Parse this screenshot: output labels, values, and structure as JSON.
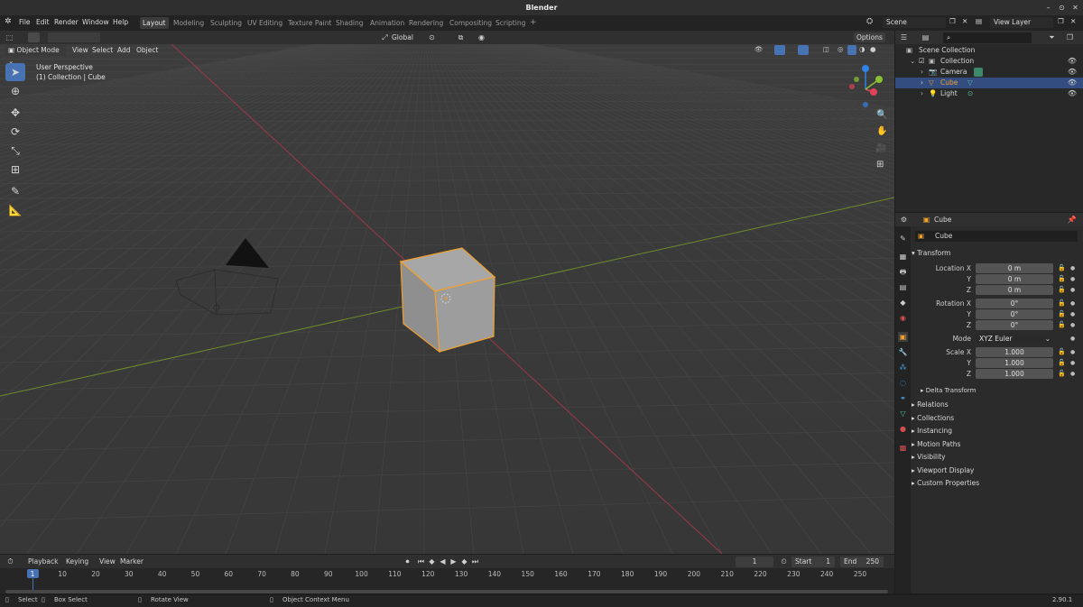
{
  "window": {
    "title": "Blender"
  },
  "menu": [
    "File",
    "Edit",
    "Render",
    "Window",
    "Help"
  ],
  "workspaces": [
    "Layout",
    "Modeling",
    "Sculpting",
    "UV Editing",
    "Texture Paint",
    "Shading",
    "Animation",
    "Rendering",
    "Compositing",
    "Scripting"
  ],
  "active_workspace": "Layout",
  "scene": {
    "name": "Scene",
    "view_layer": "View Layer"
  },
  "viewport_header": {
    "mode": "Object Mode",
    "menus": [
      "View",
      "Select",
      "Add",
      "Object"
    ],
    "transform_orientation": "Global",
    "options": "Options"
  },
  "viewport": {
    "perspective": "User Perspective",
    "context": "(1) Collection | Cube",
    "gizmo_axes": [
      "X",
      "Y",
      "Z"
    ]
  },
  "outliner": {
    "search_placeholder": "",
    "items": [
      {
        "label": "Scene Collection",
        "depth": 0,
        "icon": "scene-collection-icon"
      },
      {
        "label": "Collection",
        "depth": 1,
        "icon": "collection-icon"
      },
      {
        "label": "Camera",
        "depth": 2,
        "icon": "camera-icon"
      },
      {
        "label": "Cube",
        "depth": 2,
        "icon": "mesh-icon",
        "selected": true
      },
      {
        "label": "Light",
        "depth": 2,
        "icon": "light-icon"
      }
    ]
  },
  "properties": {
    "object_name": "Cube",
    "object_field": "Cube",
    "transform_title": "Transform",
    "location": {
      "label": "Location X",
      "x": "0 m",
      "y": "0 m",
      "z": "0 m"
    },
    "rotation": {
      "label": "Rotation X",
      "x": "0°",
      "y": "0°",
      "z": "0°"
    },
    "mode": {
      "label": "Mode",
      "value": "XYZ Euler"
    },
    "scale": {
      "label": "Scale X",
      "x": "1.000",
      "y": "1.000",
      "z": "1.000"
    },
    "axis_labels": {
      "y": "Y",
      "z": "Z"
    },
    "delta_transform": "Delta Transform",
    "sections": [
      "Relations",
      "Collections",
      "Instancing",
      "Motion Paths",
      "Visibility",
      "Viewport Display",
      "Custom Properties"
    ]
  },
  "timeline": {
    "menus": [
      "Playback",
      "Keying",
      "View",
      "Marker"
    ],
    "current_frame": "1",
    "start_label": "Start",
    "start": "1",
    "end_label": "End",
    "end": "250",
    "ticks": [
      "1",
      "10",
      "20",
      "30",
      "40",
      "50",
      "60",
      "70",
      "80",
      "90",
      "100",
      "110",
      "120",
      "130",
      "140",
      "150",
      "160",
      "170",
      "180",
      "190",
      "200",
      "210",
      "220",
      "230",
      "240",
      "250"
    ]
  },
  "statusbar": {
    "select": "Select",
    "box_select": "Box Select",
    "rotate_view": "Rotate View",
    "context_menu": "Object Context Menu",
    "version": "2.90.1"
  },
  "colors": {
    "accent": "#4772b3",
    "selection_outline": "#f0a030",
    "x_axis": "#e0425a",
    "y_axis": "#8ac034",
    "z_axis": "#2f82e6"
  }
}
